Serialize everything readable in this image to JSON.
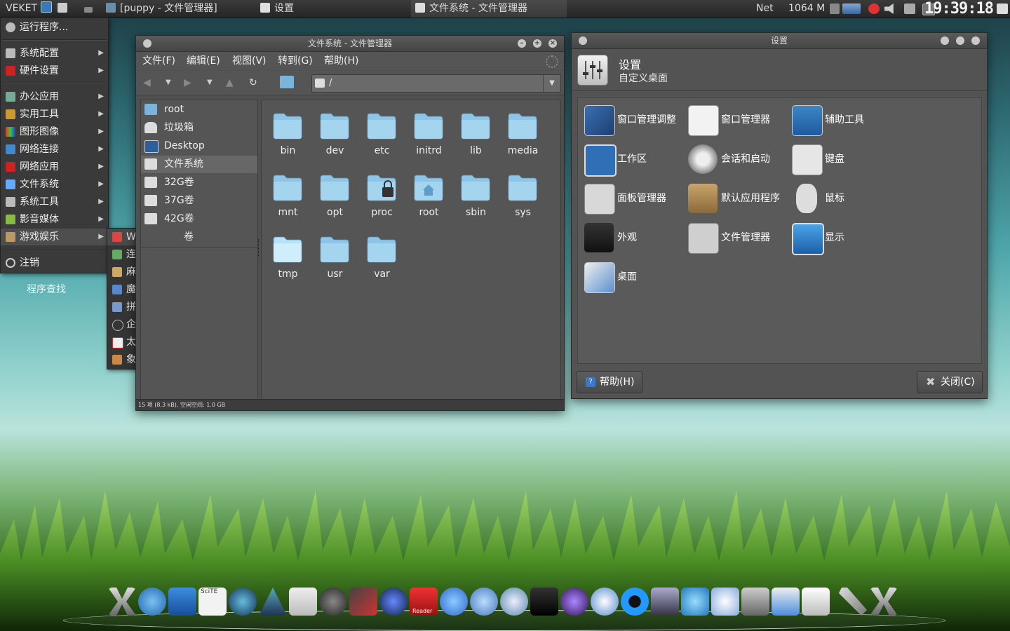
{
  "taskbar": {
    "start_label": "VEKET",
    "tasks": [
      {
        "label": "[puppy - 文件管理器]"
      },
      {
        "label": "设置"
      },
      {
        "label": "文件系统 - 文件管理器"
      }
    ],
    "net_label": "Net",
    "memory": "1064 M",
    "clock": "19:39:18"
  },
  "start_menu": {
    "items": [
      {
        "label": "运行程序...",
        "icon": "gear-icon"
      },
      {
        "label": "系统配置",
        "icon": "config-icon"
      },
      {
        "label": "硬件设置",
        "icon": "hardware-icon"
      },
      {
        "label": "办公应用",
        "icon": "office-icon"
      },
      {
        "label": "实用工具",
        "icon": "tools-icon"
      },
      {
        "label": "图形图像",
        "icon": "graphics-icon"
      },
      {
        "label": "网络连接",
        "icon": "network-icon"
      },
      {
        "label": "网络应用",
        "icon": "internet-icon"
      },
      {
        "label": "文件系统",
        "icon": "filesystem-icon"
      },
      {
        "label": "系统工具",
        "icon": "system-tools-icon"
      },
      {
        "label": "影音媒体",
        "icon": "media-icon"
      },
      {
        "label": "游戏娱乐",
        "icon": "games-icon"
      },
      {
        "label": "注销",
        "icon": "power-icon"
      }
    ],
    "search_label": "程序查找"
  },
  "games_submenu": {
    "items": [
      {
        "label": "Wine Mine"
      },
      {
        "label": "连连看游戏"
      },
      {
        "label": "麻将游戏"
      },
      {
        "label": "魔方"
      },
      {
        "label": "拼图游戏"
      },
      {
        "label": "企鹅数学"
      },
      {
        "label": "太空战"
      },
      {
        "label": "象棋"
      }
    ]
  },
  "file_manager": {
    "title": "文件系统 - 文件管理器",
    "menus": [
      "文件(F)",
      "编辑(E)",
      "视图(V)",
      "转到(G)",
      "帮助(H)"
    ],
    "path": "/",
    "sidebar": [
      {
        "label": "root"
      },
      {
        "label": "垃圾箱"
      },
      {
        "label": "Desktop"
      },
      {
        "label": "文件系统"
      },
      {
        "label": "32G卷"
      },
      {
        "label": "37G卷"
      },
      {
        "label": "42G卷"
      },
      {
        "label": "卷"
      }
    ],
    "folders": [
      "bin",
      "dev",
      "etc",
      "initrd",
      "lib",
      "media",
      "mnt",
      "opt",
      "proc",
      "root",
      "sbin",
      "sys",
      "tmp",
      "usr",
      "var"
    ],
    "status": "15 项 (8.3 kB), 空闲空间: 1.0 GB"
  },
  "settings": {
    "window_title": "设置",
    "title": "设置",
    "subtitle": "自定义桌面",
    "items": [
      {
        "label": "窗口管理调整"
      },
      {
        "label": "窗口管理器"
      },
      {
        "label": "辅助工具"
      },
      {
        "label": "工作区"
      },
      {
        "label": "会话和启动"
      },
      {
        "label": "键盘"
      },
      {
        "label": "面板管理器"
      },
      {
        "label": "默认应用程序"
      },
      {
        "label": "鼠标"
      },
      {
        "label": "外观"
      },
      {
        "label": "文件管理器"
      },
      {
        "label": "显示"
      },
      {
        "label": "桌面"
      }
    ],
    "help_label": "帮助(H)",
    "close_label": "关闭(C)"
  },
  "dock": {
    "scite_label": "SciTE",
    "reader_label": "Reader"
  },
  "colors": {
    "folder": "#8ec5e6",
    "panel": "#505050",
    "accent": "#3b86c8"
  }
}
